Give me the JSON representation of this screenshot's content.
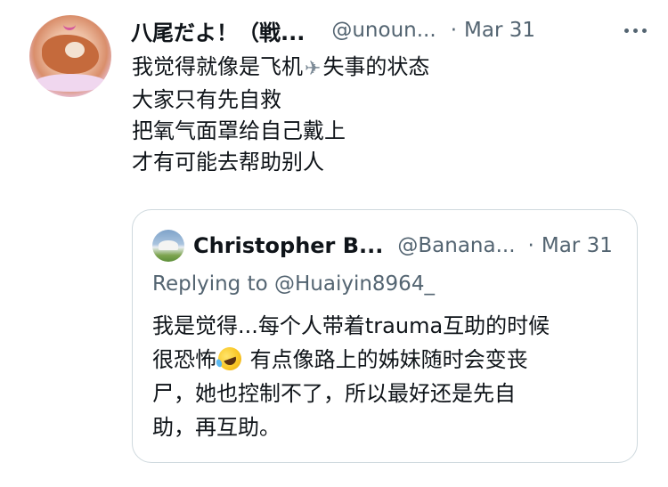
{
  "tweet": {
    "author_name": "八尾だよ！（戦...",
    "author_handle": "@unoun...",
    "separator": "·",
    "date": "Mar 31",
    "lines": [
      {
        "before": "我觉得就像是飞机",
        "icon": "airplane-icon",
        "after": "失事的状态"
      },
      {
        "text": "大家只有先自救"
      },
      {
        "text": "把氧气面罩给自己戴上"
      },
      {
        "text": "才有可能去帮助别人"
      }
    ],
    "more_icon": "more-dots-icon"
  },
  "quoted_tweet": {
    "author_name": "Christopher B...",
    "author_handle": "@Banana...",
    "separator": "·",
    "date": "Mar 31",
    "replying_to": "Replying to @Huaiyin8964_",
    "lines": [
      {
        "text": "我是觉得...每个人带着trauma互助的时候"
      },
      {
        "before": "很恐怖",
        "icon": "rolling-laughing-emoji",
        "after": " 有点像路上的姊妹随时会变丧"
      },
      {
        "text": "尸，她也控制不了，所以最好还是先自"
      },
      {
        "text": "助，再互助。"
      }
    ]
  },
  "colors": {
    "text": "#0f1419",
    "secondary": "#536471",
    "border": "#cfd9de"
  }
}
